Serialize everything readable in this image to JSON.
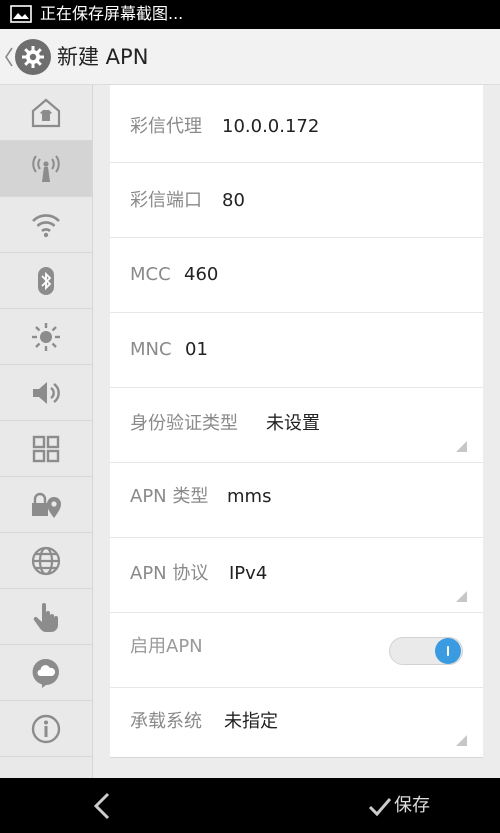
{
  "status_bar": {
    "notification_text": "正在保存屏幕截图..."
  },
  "action_bar": {
    "title": "新建 APN"
  },
  "sidebar": {
    "items": [
      {
        "icon": "home-icon",
        "active": false
      },
      {
        "icon": "antenna-icon",
        "active": true
      },
      {
        "icon": "wifi-icon",
        "active": false
      },
      {
        "icon": "bluetooth-icon",
        "active": false
      },
      {
        "icon": "brightness-icon",
        "active": false
      },
      {
        "icon": "volume-icon",
        "active": false
      },
      {
        "icon": "apps-grid-icon",
        "active": false
      },
      {
        "icon": "lock-location-icon",
        "active": false
      },
      {
        "icon": "globe-icon",
        "active": false
      },
      {
        "icon": "hand-icon",
        "active": false
      },
      {
        "icon": "cloud-icon",
        "active": false
      },
      {
        "icon": "info-icon",
        "active": false
      }
    ]
  },
  "form": {
    "rows": [
      {
        "label": "彩信代理",
        "value": "10.0.0.172"
      },
      {
        "label": "彩信端口",
        "value": "80"
      },
      {
        "label": "MCC",
        "value": "460"
      },
      {
        "label": "MNC",
        "value": "01"
      },
      {
        "label": "身份验证类型",
        "value": "未设置"
      },
      {
        "label": "APN 类型",
        "value": "mms"
      },
      {
        "label": "APN 协议",
        "value": "IPv4"
      },
      {
        "label": "启用APN",
        "value": ""
      },
      {
        "label": "承载系统",
        "value": "未指定"
      }
    ],
    "enable_apn_on": true
  },
  "nav_bar": {
    "save_label": "保存"
  },
  "colors": {
    "accent": "#3a9be0",
    "icon_gray": "#8c8c8c"
  }
}
